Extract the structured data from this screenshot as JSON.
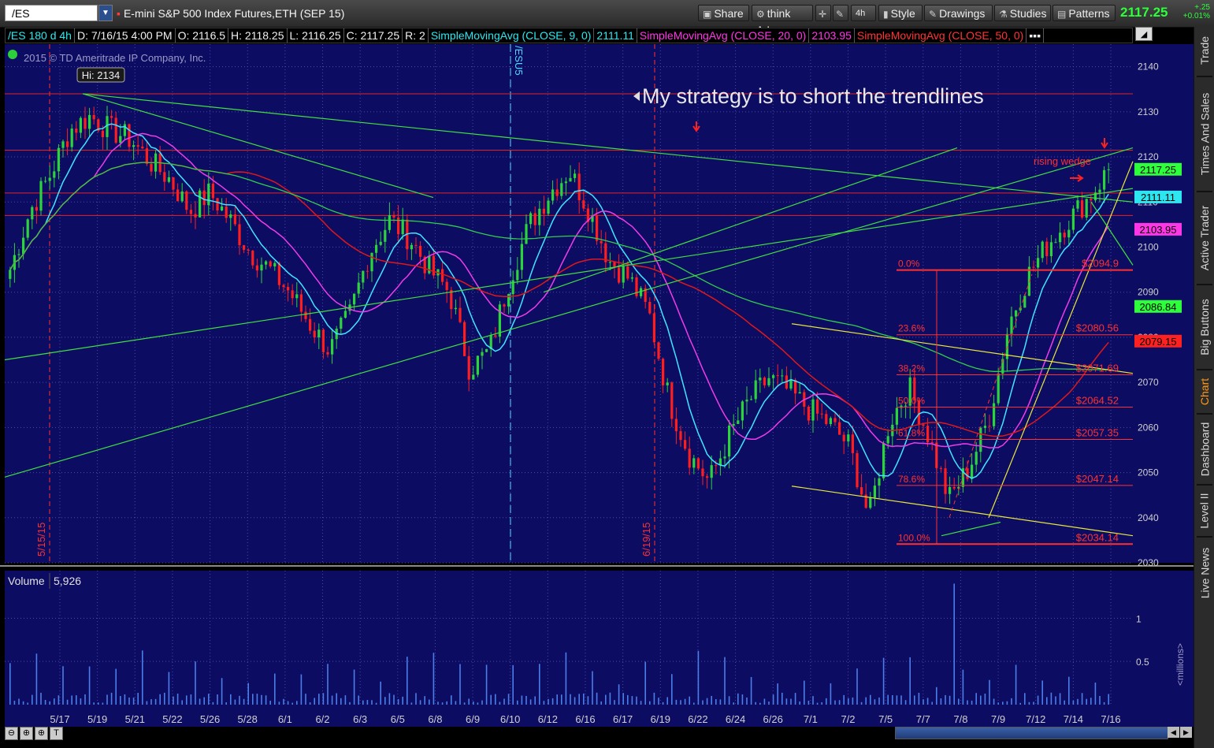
{
  "toolbar": {
    "symbol": "/ES",
    "description": "E-mini S&P 500 Index Futures,ETH (SEP 15)",
    "share": "Share",
    "think_ai": "think A.I.",
    "aggregation": "4h",
    "style": "Style",
    "drawings": "Drawings",
    "studies": "Studies",
    "patterns": "Patterns",
    "last_price": "2117.25",
    "change": "+.25",
    "change_pct": "+0.01%"
  },
  "infobar": {
    "period": "/ES 180 d 4h",
    "date": "D: 7/16/15 4:00 PM",
    "open": "O: 2116.5",
    "high": "H: 2118.25",
    "low": "L: 2116.25",
    "close": "C: 2117.25",
    "range": "R: 2",
    "sma9_label": "SimpleMovingAvg (CLOSE, 9, 0)",
    "sma9_value": "2111.11",
    "sma20_label": "SimpleMovingAvg (CLOSE, 20, 0)",
    "sma20_value": "2103.95",
    "sma50_label": "SimpleMovingAvg (CLOSE, 50, 0)"
  },
  "sidebar": [
    "Trade",
    "Times And Sales",
    "Active Trader",
    "Big Buttons",
    "Chart",
    "Dashboard",
    "Level II",
    "Live News"
  ],
  "colors": {
    "bg": "#0d0c63",
    "volume_bg": "#0d0c63",
    "up": "#2bd43b",
    "down": "#ff1e1e",
    "sma9": "#3fe6ff",
    "sma20": "#f03ce8",
    "sma50": "#e01818",
    "trend": "#3fe03f",
    "wedge": "#e8e83a",
    "fib": "#ff3030"
  },
  "chart_data": {
    "type": "candlestick",
    "title": "",
    "copyright": "2015 © TD Ameritrade IP Company, Inc.",
    "annotation": "My strategy is to short the trendlines",
    "wedge_label": "rising wedge",
    "hi_label": "Hi: 2134",
    "expiry_label": "/ESU5",
    "date_markers": [
      "5/15/15",
      "6/19/15"
    ],
    "ylim": [
      2030,
      2145
    ],
    "yticks": [
      2030,
      2040,
      2050,
      2060,
      2070,
      2080,
      2090,
      2100,
      2110,
      2120,
      2130,
      2140
    ],
    "x": [
      "5/17",
      "5/19",
      "5/21",
      "5/22",
      "5/26",
      "5/28",
      "6/1",
      "6/2",
      "6/3",
      "6/5",
      "6/8",
      "6/9",
      "6/10",
      "6/12",
      "6/16",
      "6/17",
      "6/19",
      "6/22",
      "6/24",
      "6/26",
      "7/1",
      "7/2",
      "7/5",
      "7/7",
      "7/8",
      "7/9",
      "7/12",
      "7/14",
      "7/16"
    ],
    "close_path": [
      2095,
      2108,
      2116,
      2126,
      2129,
      2126,
      2124,
      2119,
      2115,
      2108,
      2112,
      2106,
      2099,
      2095,
      2090,
      2083,
      2077,
      2085,
      2099,
      2106,
      2102,
      2095,
      2090,
      2073,
      2077,
      2093,
      2105,
      2112,
      2117,
      2108,
      2097,
      2093,
      2085,
      2066,
      2054,
      2048,
      2058,
      2066,
      2071,
      2068,
      2064,
      2061,
      2056,
      2040,
      2061,
      2069,
      2058,
      2044,
      2051,
      2062,
      2083,
      2094,
      2101,
      2106,
      2111,
      2117
    ],
    "price_labels": [
      {
        "value": 2117.25,
        "text": "2117.25",
        "color": "#2dff3a"
      },
      {
        "value": 2111.11,
        "text": "2111.11",
        "color": "#2ee6f0"
      },
      {
        "value": 2103.95,
        "text": "2103.95",
        "color": "#ff36e6"
      },
      {
        "value": 2086.84,
        "text": "2086.84",
        "color": "#2dff3a"
      },
      {
        "value": 2079.15,
        "text": "2079.15",
        "color": "#ff2020"
      }
    ],
    "fib_levels": [
      {
        "pct": "0.0%",
        "price": "$2094.9",
        "value": 2094.9
      },
      {
        "pct": "23.6%",
        "price": "$2080.56",
        "value": 2080.56
      },
      {
        "pct": "38.2%",
        "price": "$2071.69",
        "value": 2071.69
      },
      {
        "pct": "50.0%",
        "price": "$2064.52",
        "value": 2064.52
      },
      {
        "pct": "61.8%",
        "price": "$2057.35",
        "value": 2057.35
      },
      {
        "pct": "78.6%",
        "price": "$2047.14",
        "value": 2047.14
      },
      {
        "pct": "100.0%",
        "price": "$2034.14",
        "value": 2034.14
      }
    ],
    "horizontal_lines": [
      2134,
      2121.5,
      2112,
      2107
    ],
    "volume": {
      "label": "Volume",
      "last": "5,926",
      "unit": "<millions>",
      "ticks": [
        "1",
        "0.5"
      ],
      "ylim": [
        0,
        1.55
      ]
    }
  }
}
